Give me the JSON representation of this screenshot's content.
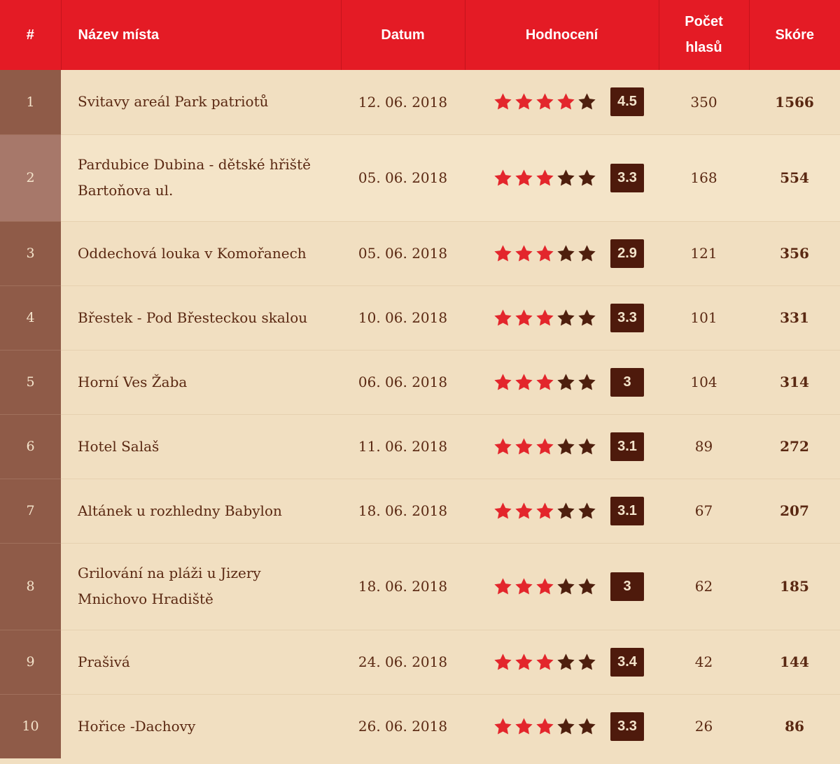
{
  "columns": {
    "rank": "#",
    "name": "Název místa",
    "date": "Datum",
    "rating": "Hodnocení",
    "votes_line1": "Počet",
    "votes_line2": "hlasů",
    "score": "Skóre"
  },
  "colors": {
    "header_bg": "#e41b25",
    "star_filled": "#e3262c",
    "star_empty": "#4e1f0e",
    "badge_bg": "#4e1a0c",
    "rank_bg": "#8f5b48",
    "row_bg": "#f1dfc1"
  },
  "rows": [
    {
      "rank": "1",
      "name": "Svitavy areál Park patriotů",
      "date": "12. 06. 2018",
      "stars_filled": 4,
      "rating": "4.5",
      "votes": "350",
      "score": "1566"
    },
    {
      "rank": "2",
      "name": "Pardubice Dubina - dětské hřiště Bartoňova ul.",
      "date": "05. 06. 2018",
      "stars_filled": 3,
      "rating": "3.3",
      "votes": "168",
      "score": "554"
    },
    {
      "rank": "3",
      "name": "Oddechová louka v Komořanech",
      "date": "05. 06. 2018",
      "stars_filled": 3,
      "rating": "2.9",
      "votes": "121",
      "score": "356"
    },
    {
      "rank": "4",
      "name": "Břestek - Pod Břesteckou skalou",
      "date": "10. 06. 2018",
      "stars_filled": 3,
      "rating": "3.3",
      "votes": "101",
      "score": "331"
    },
    {
      "rank": "5",
      "name": "Horní Ves Žaba",
      "date": "06. 06. 2018",
      "stars_filled": 3,
      "rating": "3",
      "votes": "104",
      "score": "314"
    },
    {
      "rank": "6",
      "name": "Hotel Salaš",
      "date": "11. 06. 2018",
      "stars_filled": 3,
      "rating": "3.1",
      "votes": "89",
      "score": "272"
    },
    {
      "rank": "7",
      "name": "Altánek u rozhledny Babylon",
      "date": "18. 06. 2018",
      "stars_filled": 3,
      "rating": "3.1",
      "votes": "67",
      "score": "207"
    },
    {
      "rank": "8",
      "name": "Grilování na pláži u Jizery Mnichovo Hradiště",
      "date": "18. 06. 2018",
      "stars_filled": 3,
      "rating": "3",
      "votes": "62",
      "score": "185"
    },
    {
      "rank": "9",
      "name": "Prašivá",
      "date": "24. 06. 2018",
      "stars_filled": 3,
      "rating": "3.4",
      "votes": "42",
      "score": "144"
    },
    {
      "rank": "10",
      "name": "Hořice -Dachovy",
      "date": "26. 06. 2018",
      "stars_filled": 3,
      "rating": "3.3",
      "votes": "26",
      "score": "86"
    }
  ]
}
